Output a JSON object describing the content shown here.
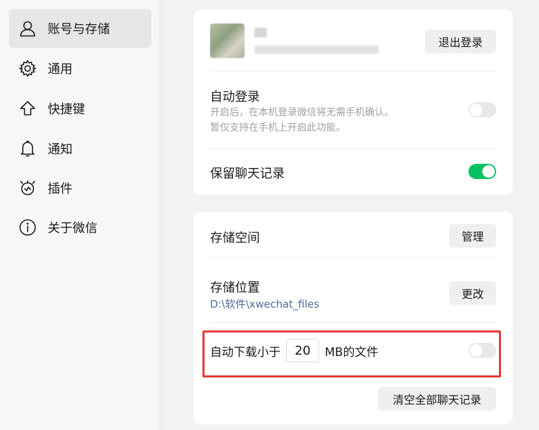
{
  "sidebar": {
    "items": [
      {
        "label": "账号与存储",
        "icon": "user-icon",
        "active": true
      },
      {
        "label": "通用",
        "icon": "gear-icon"
      },
      {
        "label": "快捷键",
        "icon": "shortcut-arrow-icon"
      },
      {
        "label": "通知",
        "icon": "bell-icon"
      },
      {
        "label": "插件",
        "icon": "plugin-icon"
      },
      {
        "label": "关于微信",
        "icon": "info-icon"
      }
    ]
  },
  "account": {
    "logout_label": "退出登录",
    "auto_login": {
      "title": "自动登录",
      "desc_line1": "开启后，在本机登录微信将无需手机确认。",
      "desc_line2": "暂仅支持在手机上开启此功能。",
      "enabled": false
    },
    "keep_history": {
      "title": "保留聊天记录",
      "enabled": true
    }
  },
  "storage": {
    "space": {
      "title": "存储空间",
      "button": "管理"
    },
    "location": {
      "title": "存储位置",
      "path": "D:\\软件\\xwechat_files",
      "button": "更改"
    },
    "auto_download": {
      "prefix": "自动下载小于",
      "value": "20",
      "suffix": "MB的文件",
      "enabled": false
    },
    "clear_button": "清空全部聊天记录"
  },
  "colors": {
    "accent_green": "#07c160",
    "highlight_red": "#e53935",
    "link_blue": "#4a6a9a"
  }
}
